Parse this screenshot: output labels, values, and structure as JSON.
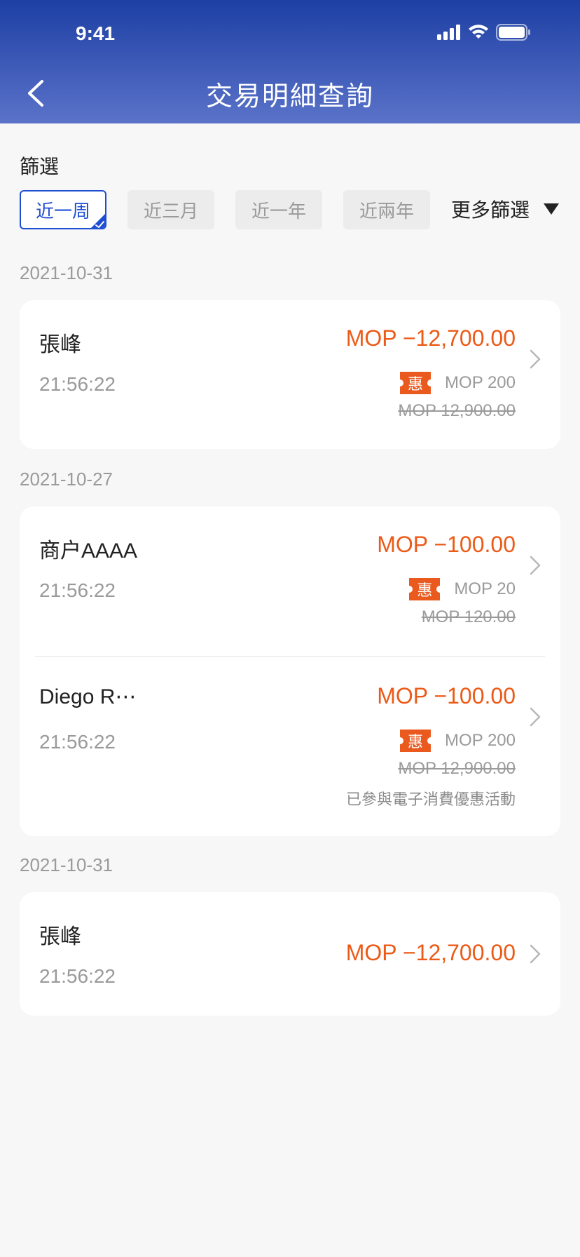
{
  "status_bar": {
    "time": "9:41"
  },
  "header": {
    "title": "交易明細查詢"
  },
  "filter": {
    "label": "篩選",
    "chips": [
      {
        "label": "近一周",
        "selected": true
      },
      {
        "label": "近三月",
        "selected": false
      },
      {
        "label": "近一年",
        "selected": false
      },
      {
        "label": "近兩年",
        "selected": false
      }
    ],
    "more_label": "更多篩選"
  },
  "sections": [
    {
      "date": "2021-10-31",
      "transactions": [
        {
          "name": "張峰",
          "time": "21:56:22",
          "amount": "MOP −12,700.00",
          "badge": "惠",
          "discount": "MOP 200",
          "original": "MOP 12,900.00"
        }
      ]
    },
    {
      "date": "2021-10-27",
      "transactions": [
        {
          "name": "商户AAAA",
          "time": "21:56:22",
          "amount": "MOP −100.00",
          "badge": "惠",
          "discount": "MOP 20",
          "original": "MOP 120.00"
        },
        {
          "name": "Diego R⋯",
          "time": "21:56:22",
          "amount": "MOP −100.00",
          "badge": "惠",
          "discount": "MOP 200",
          "original": "MOP 12,900.00",
          "note": "已參與電子消費優惠活動"
        }
      ]
    },
    {
      "date": "2021-10-31",
      "transactions": [
        {
          "name": "張峰",
          "time": "21:56:22",
          "amount": "MOP −12,700.00"
        }
      ]
    }
  ],
  "colors": {
    "header_top": "#1d3fa4",
    "header_bottom": "#5b73c9",
    "accent_blue": "#1f4fd1",
    "amount_orange": "#ec5a17",
    "badge_orange": "#ea5a1f"
  }
}
